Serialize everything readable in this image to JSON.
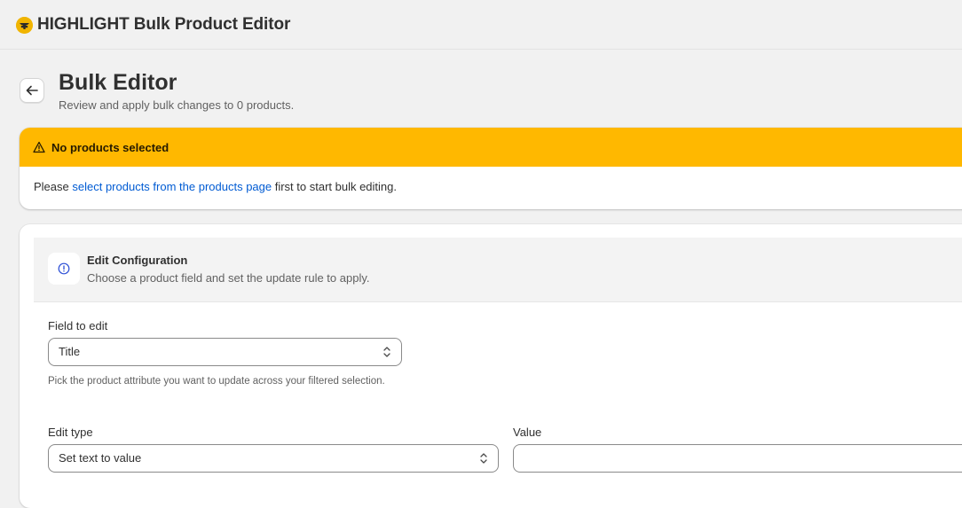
{
  "app": {
    "title": "HIGHLIGHT Bulk Product Editor",
    "logo_icon": "highlight-logo-icon"
  },
  "header": {
    "back_icon": "arrow-left-icon",
    "title": "Bulk Editor",
    "subtitle": "Review and apply bulk changes to 0 products."
  },
  "banner": {
    "color": "#ffb800",
    "icon": "warning-triangle-icon",
    "title": "No products selected",
    "body_prefix": "Please ",
    "link_text": "select products from the products page",
    "body_suffix": " first to start bulk editing."
  },
  "config": {
    "icon": "info-icon",
    "title": "Edit Configuration",
    "subtitle": "Choose a product field and set the update rule to apply.",
    "field": {
      "label": "Field to edit",
      "value": "Title",
      "help": "Pick the product attribute you want to update across your filtered selection."
    },
    "edit_type": {
      "label": "Edit type",
      "value": "Set text to value"
    },
    "value_field": {
      "label": "Value",
      "value": ""
    }
  }
}
